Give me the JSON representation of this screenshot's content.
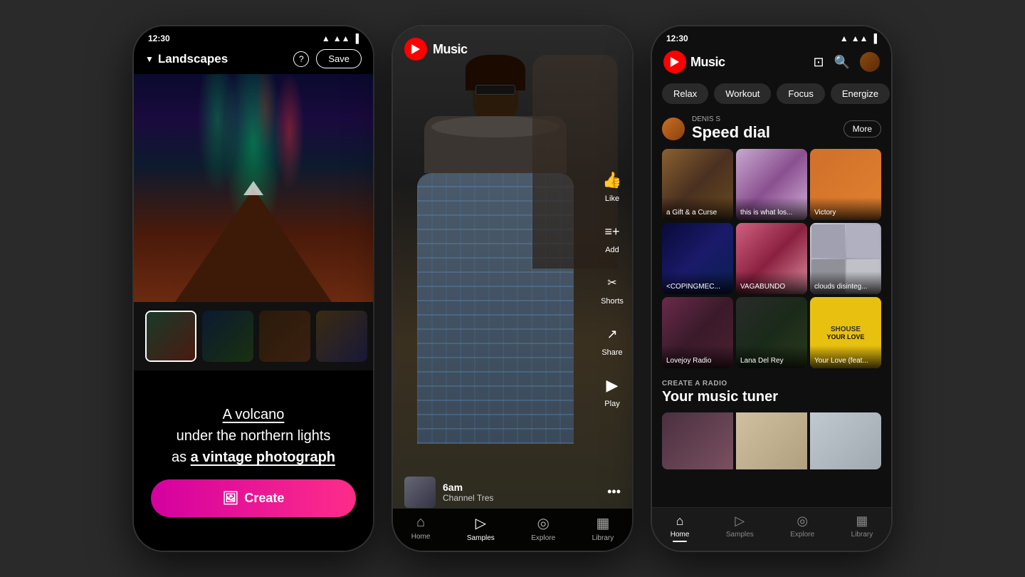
{
  "phone1": {
    "status": {
      "time": "12:30"
    },
    "header": {
      "title": "Landscapes",
      "save_label": "Save"
    },
    "prompt": {
      "line1": "A volcano",
      "line2": "under the northern lights",
      "line3": "as",
      "line4": "a vintage photograph"
    },
    "create_label": "Create",
    "thumbnails": [
      {
        "id": "thumb1",
        "selected": true
      },
      {
        "id": "thumb2",
        "selected": false
      },
      {
        "id": "thumb3",
        "selected": false
      },
      {
        "id": "thumb4",
        "selected": false
      }
    ]
  },
  "phone2": {
    "header": {
      "logo_text": "Music"
    },
    "track": {
      "title": "6am",
      "artist": "Channel Tres"
    },
    "actions": [
      {
        "id": "like",
        "label": "Like",
        "icon": "👍"
      },
      {
        "id": "add",
        "label": "Add",
        "icon": "☰"
      },
      {
        "id": "shorts",
        "label": "Shorts",
        "icon": "✂"
      },
      {
        "id": "share",
        "label": "Share",
        "icon": "↗"
      },
      {
        "id": "play",
        "label": "Play",
        "icon": "▶"
      }
    ],
    "nav": [
      {
        "id": "home",
        "label": "Home",
        "icon": "⌂",
        "active": false
      },
      {
        "id": "samples",
        "label": "Samples",
        "icon": "▷",
        "active": true
      },
      {
        "id": "explore",
        "label": "Explore",
        "icon": "◎",
        "active": false
      },
      {
        "id": "library",
        "label": "Library",
        "icon": "▦",
        "active": false
      }
    ]
  },
  "phone3": {
    "status": {
      "time": "12:30"
    },
    "header": {
      "logo_text": "Music"
    },
    "chips": [
      {
        "id": "relax",
        "label": "Relax",
        "active": false
      },
      {
        "id": "workout",
        "label": "Workout",
        "active": false
      },
      {
        "id": "focus",
        "label": "Focus",
        "active": false
      },
      {
        "id": "energize",
        "label": "Energize",
        "active": false
      }
    ],
    "speed_dial": {
      "user_label": "DENIS S",
      "section_title": "Speed dial",
      "more_label": "More",
      "items": [
        {
          "id": "item1",
          "label": "a Gift & a Curse",
          "art_class": "art-1"
        },
        {
          "id": "item2",
          "label": "this is what los...",
          "art_class": "art-2"
        },
        {
          "id": "item3",
          "label": "Victory",
          "art_class": "art-3"
        },
        {
          "id": "item4",
          "label": "<COPINGMEC...",
          "art_class": "art-4"
        },
        {
          "id": "item5",
          "label": "VAGABUNDO",
          "art_class": "art-5"
        },
        {
          "id": "item6",
          "label": "clouds disinteg...",
          "art_class": "art-6"
        },
        {
          "id": "item7",
          "label": "Lovejoy Radio",
          "art_class": "art-7"
        },
        {
          "id": "item8",
          "label": "Lana Del Rey",
          "art_class": "art-8"
        },
        {
          "id": "item9",
          "label": "Your Love (feat...",
          "art_class": "art-9"
        }
      ]
    },
    "radio": {
      "section_label": "CREATE A RADIO",
      "title": "Your music tuner"
    },
    "nav": [
      {
        "id": "home",
        "label": "Home",
        "icon": "⌂",
        "active": true
      },
      {
        "id": "samples",
        "label": "Samples",
        "icon": "▷",
        "active": false
      },
      {
        "id": "explore",
        "label": "Explore",
        "icon": "◎",
        "active": false
      },
      {
        "id": "library",
        "label": "Library",
        "icon": "▦",
        "active": false
      }
    ]
  }
}
